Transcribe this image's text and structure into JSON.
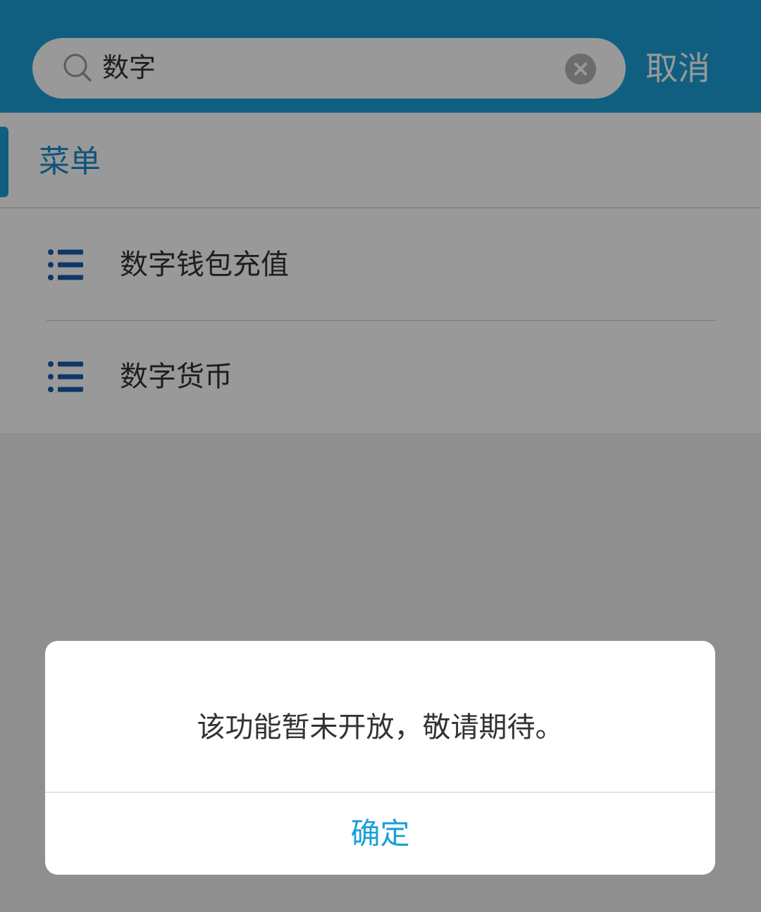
{
  "colors": {
    "header_bg": "#1b9fd8",
    "accent": "#1b9fd8",
    "list_icon": "#1a5aa8",
    "overlay": "rgba(0,0,0,0.40)"
  },
  "search": {
    "icon": "search-icon",
    "value": "数字",
    "clear_icon": "close-circle-icon",
    "cancel_label": "取消"
  },
  "section": {
    "title": "菜单"
  },
  "results": [
    {
      "icon": "list-icon",
      "label": "数字钱包充值"
    },
    {
      "icon": "list-icon",
      "label": "数字货币"
    }
  ],
  "dialog": {
    "message": "该功能暂未开放，敬请期待。",
    "confirm_label": "确定"
  }
}
